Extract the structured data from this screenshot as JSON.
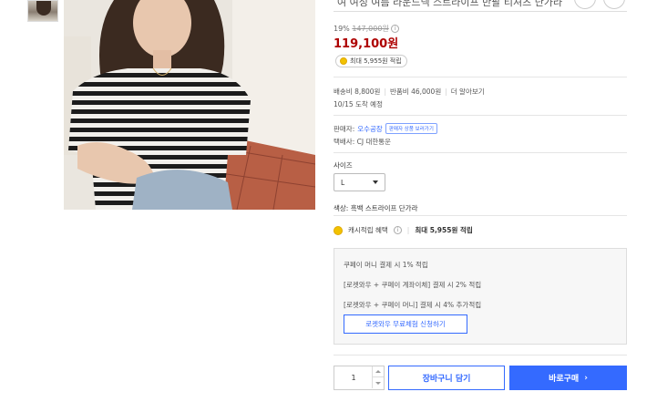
{
  "product": {
    "title_cut": "여 여성 여름 라운드넥 스트라이프 반팔 티셔츠 단가라",
    "discount_rate": "19%",
    "original_price": "147,000원",
    "price": "119,100원",
    "reward_chip": "최대 5,955원 적립"
  },
  "shipping": {
    "fee": "배송비 8,800원",
    "return_fee": "반품비 46,000원",
    "more": "더 알아보기",
    "eta": "10/15 도착 예정"
  },
  "seller": {
    "label": "판매자:",
    "name": "오수공장",
    "other_products": "판매자 상품 보러가기",
    "courier": "택배사: CJ 대한통운"
  },
  "option": {
    "size_label": "사이즈",
    "size_value": "L",
    "color_line": "색상: 흑백 스트라이프 단가라"
  },
  "cash_reward": {
    "label": "캐시적립 혜택",
    "amount": "최대 5,955원 적립"
  },
  "pay_box": {
    "line1": "쿠페이 머니 결제 시 1% 적립",
    "line2": "[로켓와우 + 쿠페이 계좌이체] 결제 시 2% 적립",
    "line3": "[로켓와우 + 쿠페이 머니] 결제 시 4% 추가적립",
    "trial_button": "로켓와우 무료체험 신청하기"
  },
  "purchase": {
    "quantity": "1",
    "cart_button": "장바구니 담기",
    "buy_button": "바로구매",
    "buy_arrow": "›"
  },
  "icons": {
    "info": "info-icon",
    "coin": "coin-icon",
    "caret": "chevron-down-icon"
  },
  "colors": {
    "price_red": "#ae0000",
    "accent_blue": "#346aff",
    "coin_yellow": "#f2c200"
  }
}
